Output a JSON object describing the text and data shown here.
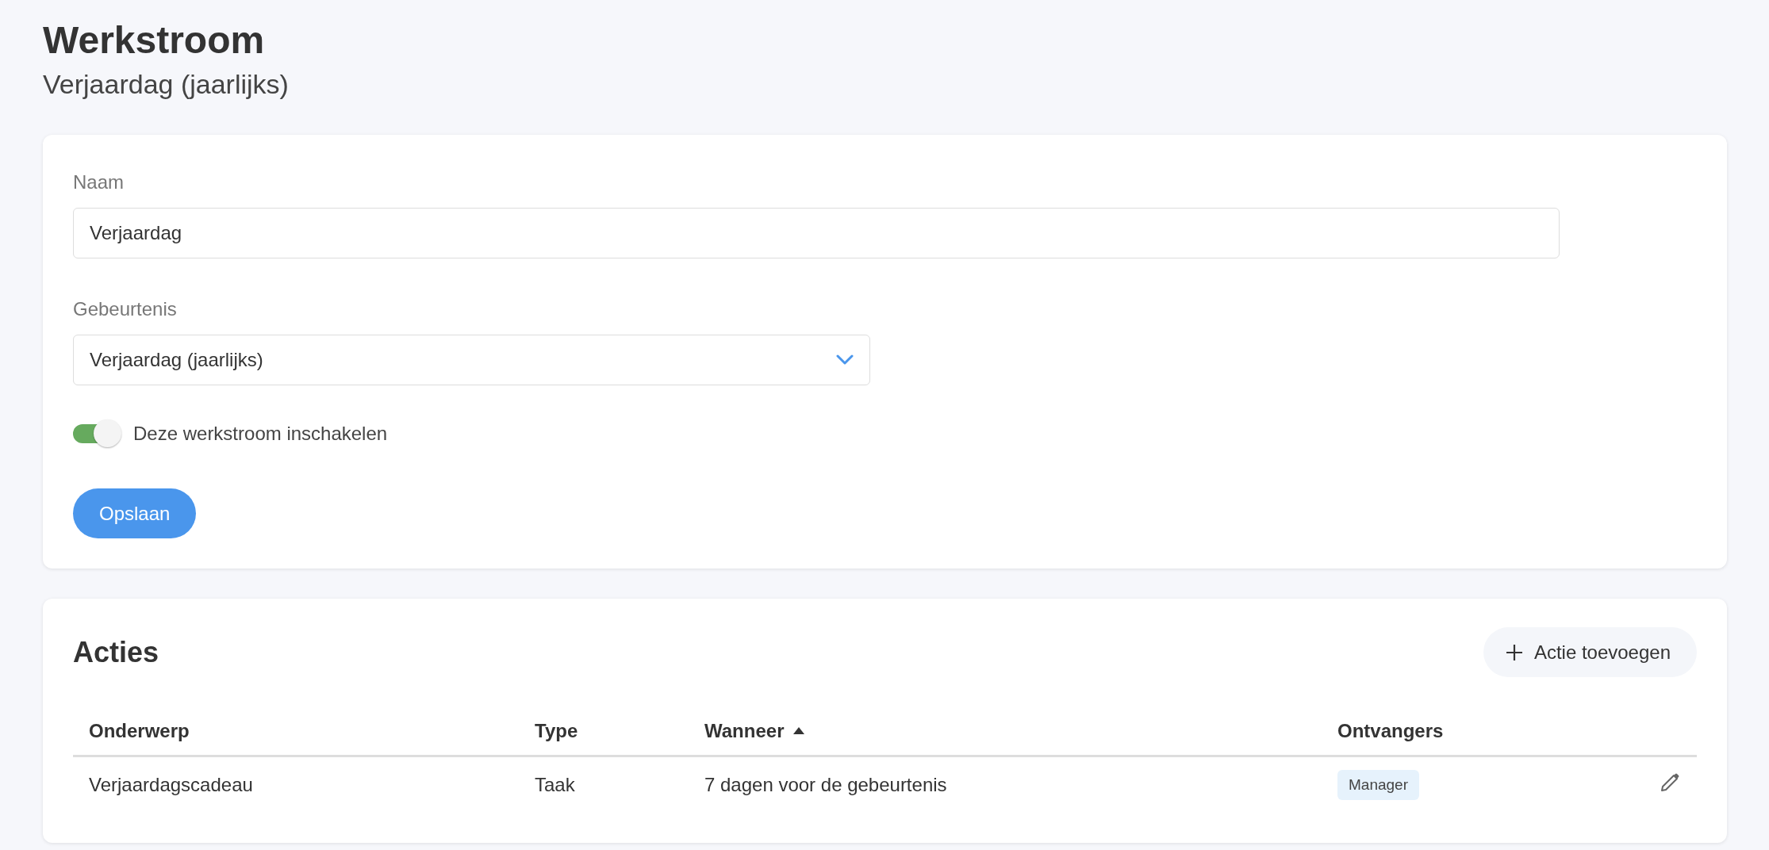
{
  "header": {
    "title": "Werkstroom",
    "subtitle": "Verjaardag (jaarlijks)"
  },
  "form": {
    "name_field": {
      "label": "Naam",
      "value": "Verjaardag"
    },
    "event_field": {
      "label": "Gebeurtenis",
      "value": "Verjaardag (jaarlijks)"
    },
    "enable_toggle": {
      "label": "Deze werkstroom inschakelen",
      "on": true
    },
    "save_button": "Opslaan"
  },
  "actions": {
    "title": "Acties",
    "add_button": "Actie toevoegen",
    "columns": [
      {
        "label": "Onderwerp",
        "sorted": false
      },
      {
        "label": "Type",
        "sorted": false
      },
      {
        "label": "Wanneer",
        "sorted": true
      },
      {
        "label": "Ontvangers",
        "sorted": false
      }
    ],
    "rows": [
      {
        "subject": "Verjaardagscadeau",
        "type": "Taak",
        "when": "7 dagen voor de gebeurtenis",
        "recipients": [
          "Manager"
        ]
      }
    ]
  }
}
